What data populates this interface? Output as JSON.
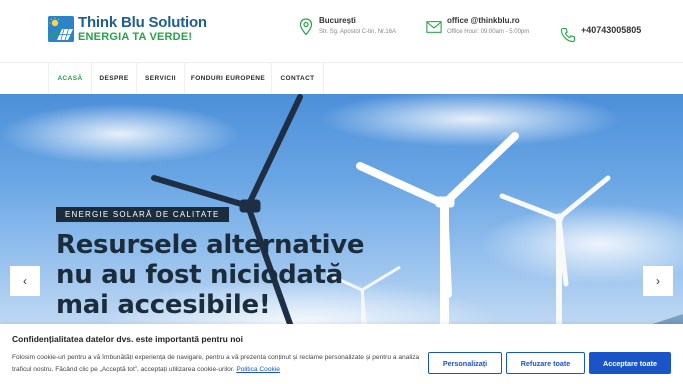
{
  "brand": {
    "name": "Think Blu Solution",
    "tagline": "ENERGIA TA VERDE!"
  },
  "contact": {
    "address_title": "București",
    "address_detail": "Str. Sg. Apostol C-tin, Nr.16A",
    "email_title": "office @thinkblu.ro",
    "email_detail": "Office Hour: 09:00am - 5:00pm",
    "phone": "+40743005805"
  },
  "nav": {
    "items": [
      {
        "label": "ACASĂ",
        "active": true
      },
      {
        "label": "DESPRE"
      },
      {
        "label": "SERVICII"
      },
      {
        "label": "FONDURI EUROPENE"
      },
      {
        "label": "CONTACT"
      }
    ]
  },
  "hero": {
    "badge": "ENERGIE SOLARĂ DE CALITATE",
    "headline": "Resursele alternative nu au fost niciodată mai accesibile!",
    "prev_arrow": "‹",
    "next_arrow": "›"
  },
  "cookie": {
    "title": "Confidențialitatea datelor dvs. este importantă pentru noi",
    "text": "Folosim cookie-uri pentru a vă îmbunătăți experiența de navigare, pentru a vă prezenta conținut și reclame personalizate și pentru a analiza traficul nostru. Făcând clic pe „Acceptă tot”, acceptați utilizarea cookie-urilor.",
    "policy_link": "Politica Cookie",
    "btn_customize": "Personalizați",
    "btn_reject": "Refuzare toate",
    "btn_accept": "Acceptare toate"
  },
  "colors": {
    "brand_blue": "#1f5f8f",
    "brand_green": "#27a24a",
    "dark_navy": "#1b2d3d",
    "cookie_blue": "#1a55c7"
  },
  "icons": {
    "address": "map-pin-icon",
    "email": "envelope-icon",
    "phone": "phone-icon"
  }
}
